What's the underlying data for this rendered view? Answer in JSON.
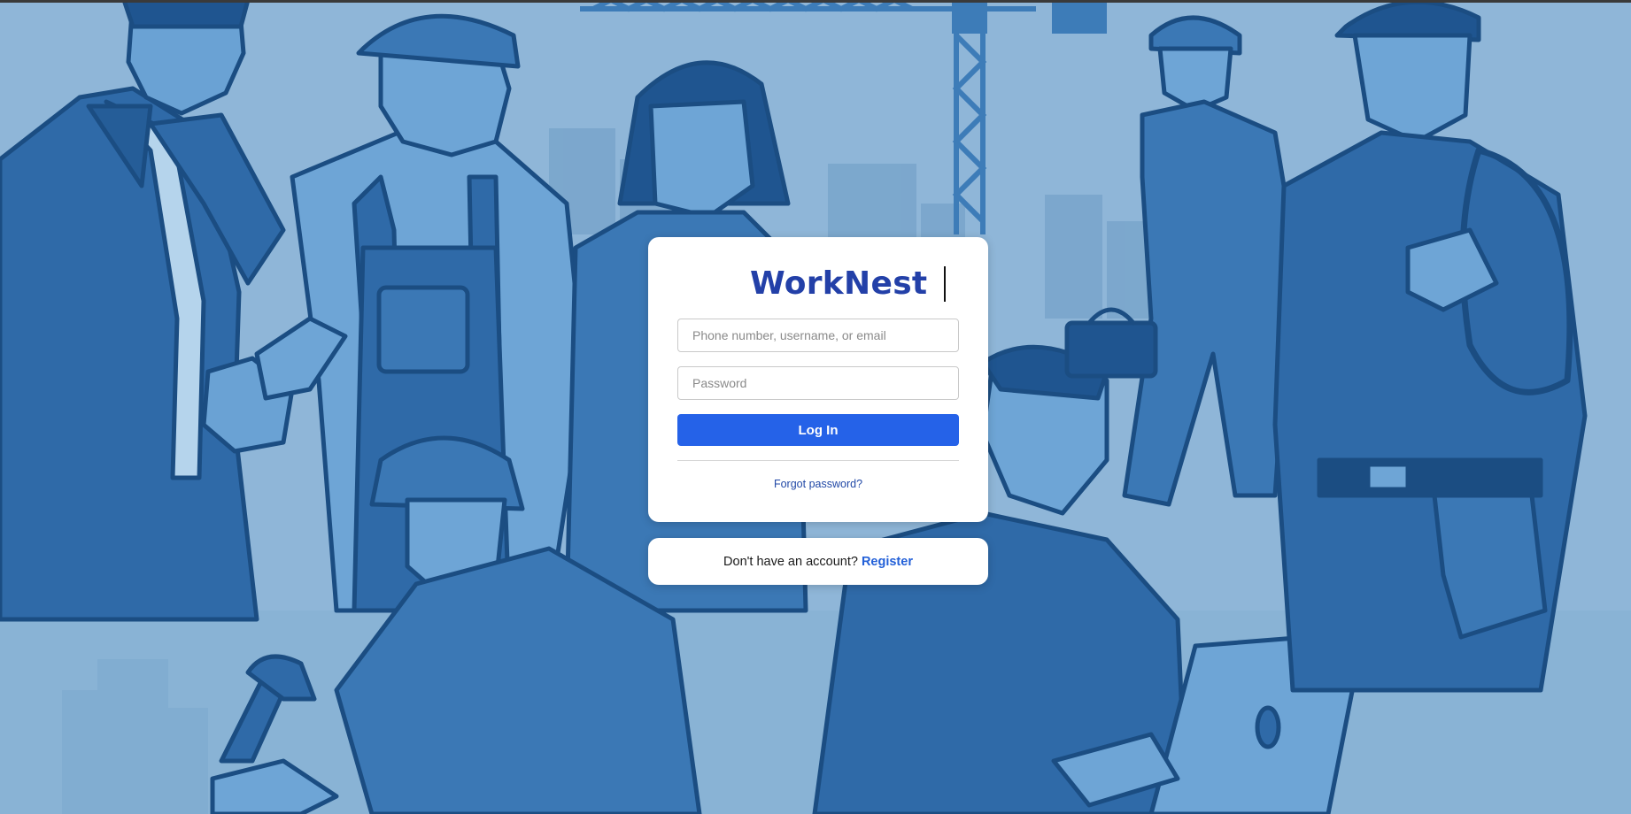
{
  "app": {
    "name": "WorkNest"
  },
  "login": {
    "identity_placeholder": "Phone number, username, or email",
    "identity_value": "",
    "password_placeholder": "Password",
    "password_value": "",
    "submit_label": "Log In",
    "forgot_label": "Forgot password?"
  },
  "register": {
    "prompt": "Don't have an account?",
    "link_label": "Register"
  },
  "background": {
    "description_icon": "construction-workers-illustration",
    "tone": "#8fb6d8"
  },
  "colors": {
    "brand": "#2340a8",
    "primary_button": "#2562e8",
    "link": "#2360d8"
  }
}
